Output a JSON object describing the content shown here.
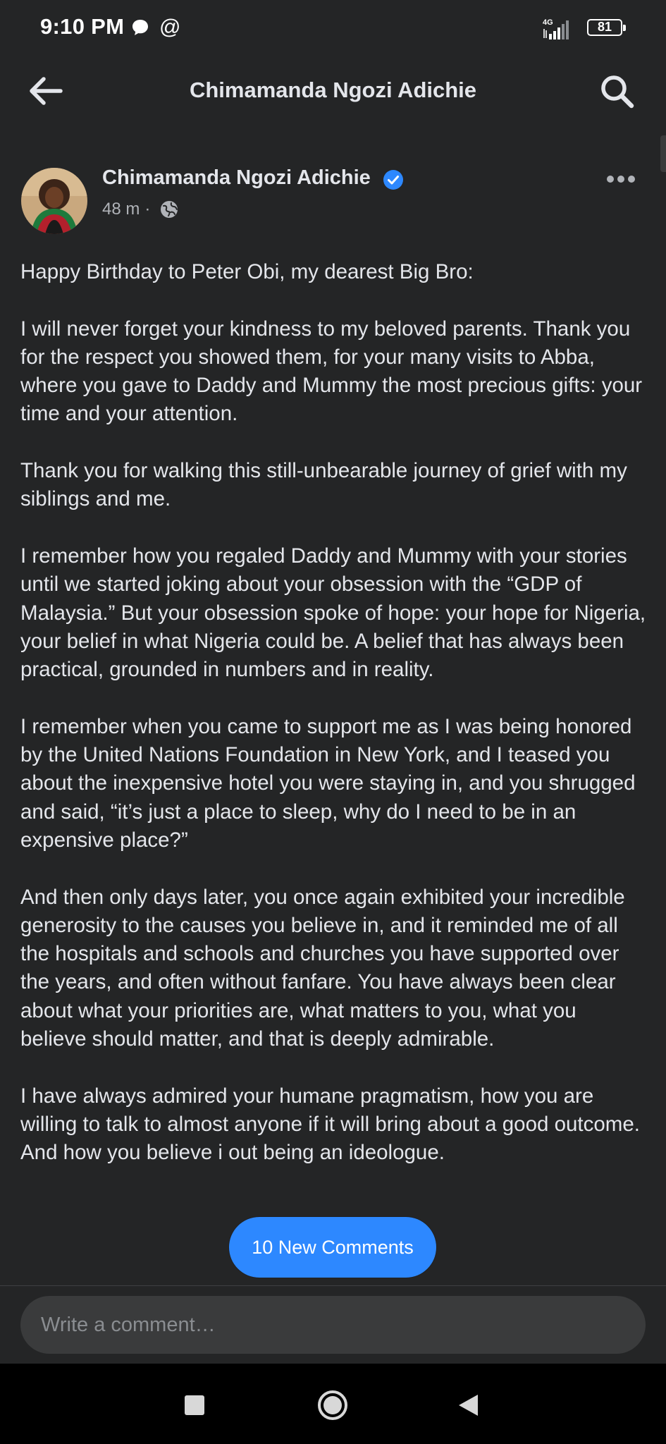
{
  "status_bar": {
    "time": "9:10 PM",
    "at_symbol": "@",
    "network": "4G",
    "battery": "81",
    "icons": [
      "chat-bubble-icon",
      "signal-icon",
      "battery-icon"
    ]
  },
  "header": {
    "title": "Chimamanda Ngozi Adichie",
    "icons": [
      "back-arrow-icon",
      "search-icon"
    ]
  },
  "post": {
    "author": "Chimamanda Ngozi Adichie",
    "verified": true,
    "time": "48 m",
    "separator": "·",
    "privacy_icon": "globe-icon",
    "more_icon": "more-dots-icon",
    "paragraphs": [
      "Happy Birthday to Peter Obi, my dearest Big Bro:",
      "I will never forget your kindness to my beloved parents. Thank you for the respect you showed them, for your many visits to Abba, where you gave to Daddy and Mummy the most precious gifts: your time and your attention.",
      "Thank you for walking this still-unbearable journey of grief with my siblings and me.",
      "I remember how you regaled Daddy and Mummy with your stories until we started joking about your obsession with the “GDP of Malaysia.” But your obsession spoke of hope: your hope for Nigeria, your belief in what Nigeria could be. A belief that has always been practical, grounded in numbers and in reality.",
      "I remember when you came to support me as I was being honored by the United Nations Foundation in New York, and I teased you about the inexpensive hotel you were staying in, and you shrugged and said, “it’s just a place to sleep, why do I need to be in an expensive place?”",
      "And then only days later, you once again exhibited your incredible generosity to the causes you believe in, and it reminded me of all the hospitals and schools and churches you have supported over the years, and often without fanfare. You have always been clear about what your priorities are, what matters to you, what you believe should matter, and that is deeply admirable.",
      "I have always admired your humane pragmatism, how you are willing to talk to almost anyone if it will bring about a good outcome.",
      "And how you believe i                                        out being an ideologue."
    ]
  },
  "new_comments_button": "10 New Comments",
  "comment_box": {
    "placeholder": "Write a comment…"
  },
  "nav_bar": {
    "icons": [
      "recents-square-icon",
      "home-circle-icon",
      "back-triangle-icon"
    ]
  },
  "colors": {
    "background": "#242526",
    "text": "#e4e6eb",
    "secondary_text": "#b0b3b8",
    "accent": "#2d88ff",
    "input_bg": "#3a3b3c"
  }
}
